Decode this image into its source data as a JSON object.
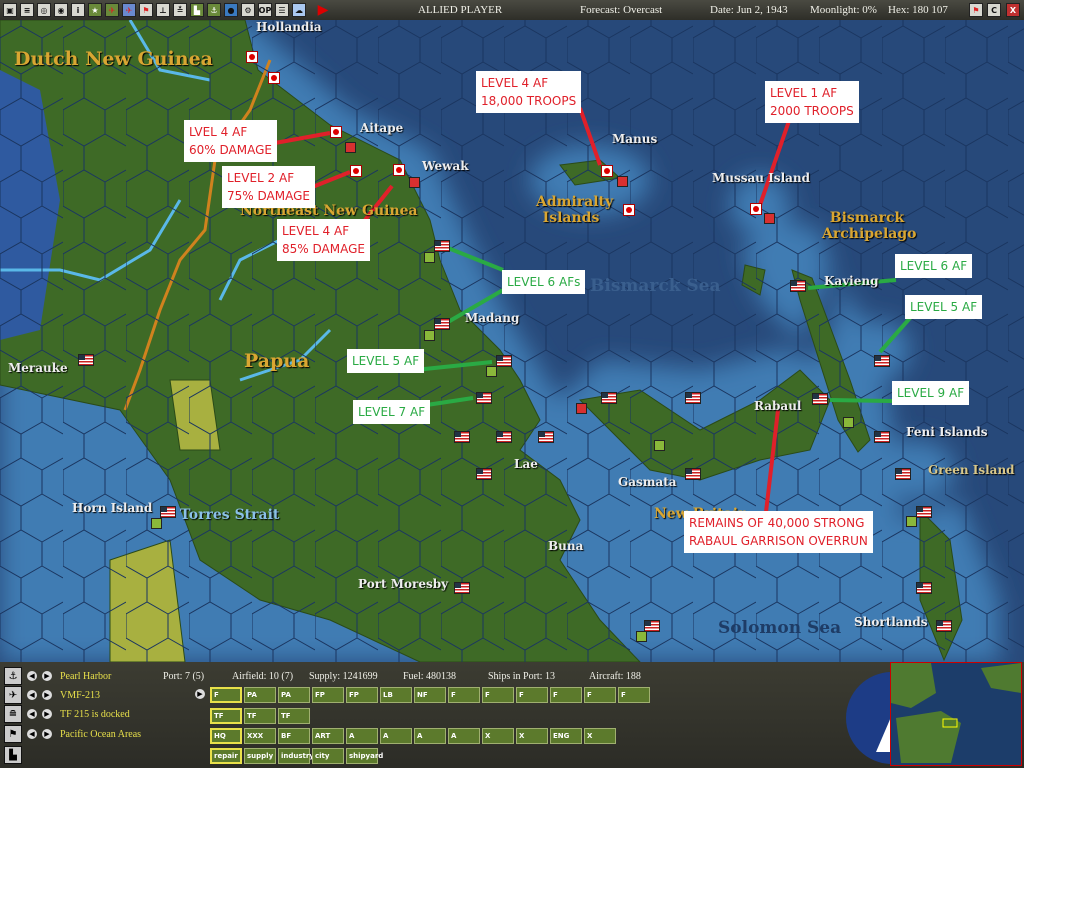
{
  "topbar": {
    "icons": [
      "carrier-icon",
      "list-icon",
      "group-icon",
      "ship-icon",
      "info-icon",
      "star-icon",
      "fighter-icon",
      "bomber-icon",
      "flag-icon",
      "ground-icon",
      "lcu-icon",
      "factory-icon",
      "port-icon",
      "globe-icon",
      "settings-icon",
      "ops-icon",
      "report-icon",
      "weather-icon"
    ],
    "ops_label": "OP",
    "info_label": "i",
    "end_turn_icon": "play-icon",
    "player": "ALLIED PLAYER",
    "forecast": "Forecast: Overcast",
    "date": "Date: Jun 2, 1943",
    "moonlight": "Moonlight: 0%",
    "hex": "Hex: 180 107",
    "right_buttons": [
      {
        "icon": "flag-icon"
      },
      {
        "label": "C"
      },
      {
        "label": "X"
      }
    ]
  },
  "map": {
    "regions": [
      "Dutch New Guinea",
      "Northeast New Guinea",
      "Papua",
      "Admiralty Islands",
      "Bismarck Archipelago",
      "New Britain"
    ],
    "places": [
      "Hollandia",
      "Aitape",
      "Wewak",
      "Madang",
      "Manus",
      "Mussau Island",
      "Kavieng",
      "Merauke",
      "Lae",
      "Gasmata",
      "Rabaul",
      "Feni Islands",
      "Green Island",
      "Horn Island",
      "Torres Strait",
      "Buna",
      "Port Moresby",
      "Shortlands",
      "Bismarck Sea",
      "Solomon Sea"
    ],
    "callouts": [
      {
        "lines": [
          "LVEL 4 AF",
          "60% DAMAGE"
        ],
        "color": "red"
      },
      {
        "lines": [
          "LEVEL 2 AF",
          "75% DAMAGE"
        ],
        "color": "red"
      },
      {
        "lines": [
          "LEVEL 4 AF",
          "85% DAMAGE"
        ],
        "color": "red"
      },
      {
        "lines": [
          "LEVEL 4 AF",
          "18,000 TROOPS"
        ],
        "color": "red"
      },
      {
        "lines": [
          "LEVEL 1 AF",
          "2000 TROOPS"
        ],
        "color": "red"
      },
      {
        "lines": [
          "LEVEL 6 AFs"
        ],
        "color": "green"
      },
      {
        "lines": [
          "LEVEL 5 AF"
        ],
        "color": "green"
      },
      {
        "lines": [
          "LEVEL 7 AF"
        ],
        "color": "green"
      },
      {
        "lines": [
          "LEVEL 6 AF"
        ],
        "color": "green"
      },
      {
        "lines": [
          "LEVEL 5 AF"
        ],
        "color": "green"
      },
      {
        "lines": [
          "LEVEL 9 AF"
        ],
        "color": "green"
      },
      {
        "lines": [
          "REMAINS OF 40,000 STRONG",
          "RABAUL GARRISON OVERRUN"
        ],
        "color": "red"
      }
    ],
    "colors": {
      "deep": "#27497a",
      "shallow": "#3f7bb3",
      "land": "#3e6a26",
      "red": "#e0202a",
      "green": "#2aaa44"
    }
  },
  "panel": {
    "rows": [
      {
        "icon": "anchor-icon",
        "label": "Pearl Harbor"
      },
      {
        "icon": "plane-icon",
        "label": "VMF-213"
      },
      {
        "icon": "ship-icon",
        "label": "TF 215 is docked"
      },
      {
        "icon": "flag-icon",
        "label": "Pacific Ocean Areas"
      },
      {
        "icon": "factory-icon",
        "label": ""
      }
    ],
    "stats": {
      "port": "Port: 7 (5)",
      "airfield": "Airfield: 10 (7)",
      "supply": "Supply: 1241699",
      "fuel": "Fuel: 480138",
      "ships": "Ships in Port: 13",
      "aircraft": "Aircraft: 188"
    },
    "air_units": [
      "F",
      "PA",
      "PA",
      "FP",
      "FP",
      "LB",
      "NF",
      "F",
      "F",
      "F",
      "F",
      "F",
      "F"
    ],
    "ship_units": [
      "TF",
      "TF",
      "TF"
    ],
    "ground_buttons": [
      "HQ",
      "XXX",
      "BF",
      "ART",
      "A",
      "A",
      "A",
      "A",
      "X",
      "X",
      "ENG",
      "X"
    ],
    "facility_buttons": [
      "repair",
      "supply",
      "industry",
      "city",
      "shipyard"
    ]
  }
}
